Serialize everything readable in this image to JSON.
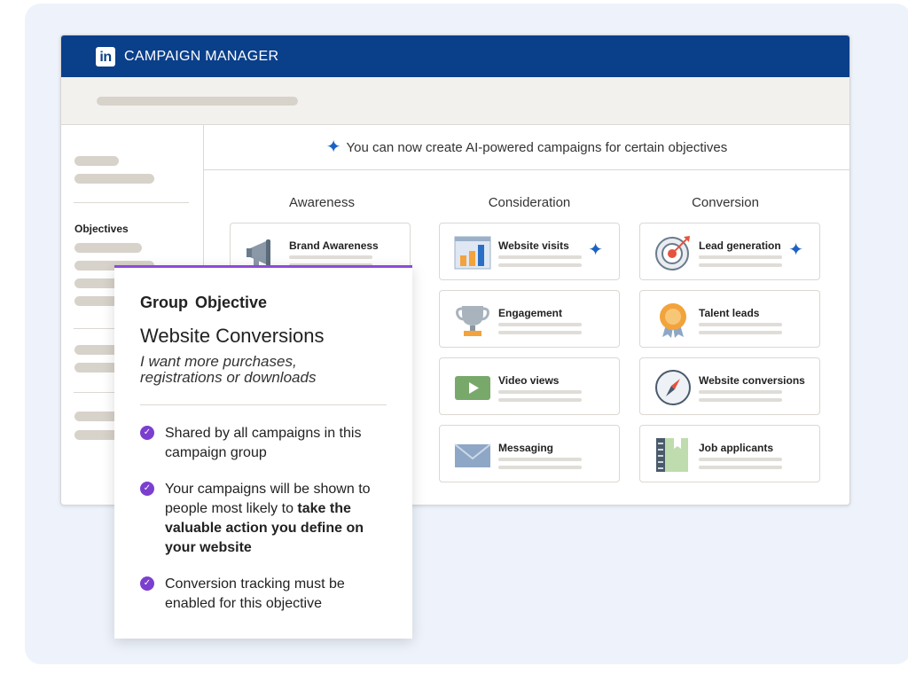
{
  "header": {
    "logo_text": "in",
    "title": "CAMPAIGN MANAGER"
  },
  "sidebar": {
    "objectives_label": "Objectives"
  },
  "banner": {
    "text": "You can now create AI-powered campaigns for certain objectives"
  },
  "columns": {
    "awareness": "Awareness",
    "consideration": "Consideration",
    "conversion": "Conversion"
  },
  "cards": {
    "brand_awareness": "Brand Awareness",
    "website_visits": "Website visits",
    "engagement": "Engagement",
    "video_views": "Video views",
    "messaging": "Messaging",
    "lead_generation": "Lead generation",
    "talent_leads": "Talent leads",
    "website_conversions": "Website conversions",
    "job_applicants": "Job applicants"
  },
  "popup": {
    "heading": "Group Objective",
    "objective": "Website Conversions",
    "description": "I want more purchases, registrations or downloads",
    "bullet1": "Shared by all campaigns in this campaign group",
    "bullet2_pre": "Your campaigns will be shown to people most likely to ",
    "bullet2_bold": "take the valuable action you define on your website",
    "bullet3": "Conversion tracking must be enabled for this objective"
  },
  "colors": {
    "brand": "#0a3f8a",
    "accent": "#7b3fcf",
    "ai_spark": "#1c62c4"
  },
  "icons": [
    "linkedin-logo",
    "ai-spark-icon",
    "megaphone-icon",
    "bar-chart-icon",
    "trophy-icon",
    "play-video-icon",
    "envelope-icon",
    "target-icon",
    "award-badge-icon",
    "compass-icon",
    "notebook-icon",
    "check-circle-icon"
  ]
}
